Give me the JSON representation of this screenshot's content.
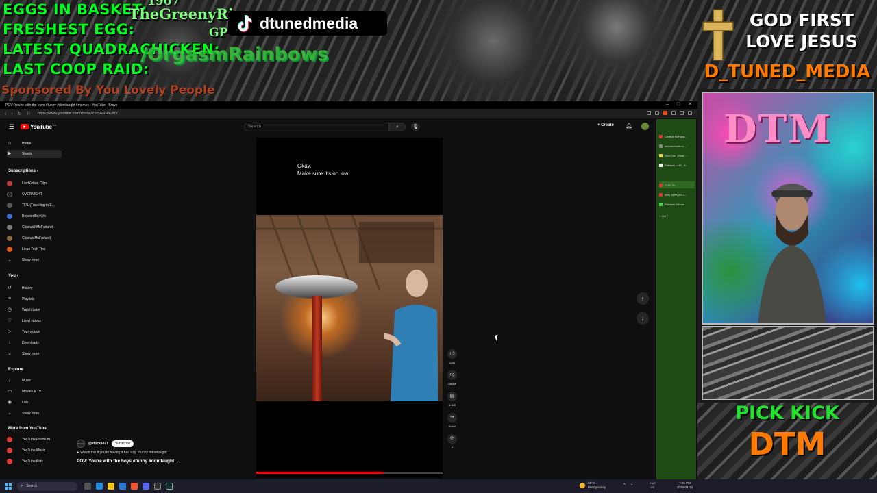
{
  "overlay": {
    "stats": [
      "EGGS IN BASKET:",
      "FRESHEST EGG:",
      "LATEST QUADRACHICKEN:",
      "LAST COOP RAID:"
    ],
    "latest_egg_user": "TheGreenyRi",
    "top_number": "1967",
    "gp_text": "GP",
    "raid_user": "/OrgasmRainbows",
    "sponsor": "Sponsored By You Lovely People",
    "tiktok_handle": "dtunedmedia",
    "slogan_line1": "GOD FIRST",
    "slogan_line2": "LOVE JESUS",
    "brand": "D_TUNED_MEDIA",
    "webcam_sign": "DTM",
    "pick_kick": "PICK KICK",
    "dtm_big": "DTM"
  },
  "browser": {
    "tab_title": "POV: You're with the boys #funny #dontlaught #memes - YouTube - Brave",
    "url": "https://www.youtube.com/shorts/Z5fSNRHYDbY",
    "window_controls": [
      "–",
      "□",
      "✕"
    ]
  },
  "youtube": {
    "logo": "YouTube",
    "country": "CA",
    "search_placeholder": "Search",
    "create_label": "Create",
    "sidebar": {
      "top": [
        {
          "label": "Home",
          "icon": "home-icon",
          "glyph": "⌂"
        },
        {
          "label": "Shorts",
          "icon": "shorts-icon",
          "glyph": "▶"
        }
      ],
      "subscriptions_head": "Subscriptions",
      "subscriptions": [
        {
          "label": "LordKebun Clips",
          "color": "#c23b3b"
        },
        {
          "label": "OVERNIGHT",
          "color": "#222222"
        },
        {
          "label": "TFIL (Traveling to E...",
          "color": "#555555"
        },
        {
          "label": "BoostedBoiKyle",
          "color": "#3a6fd0"
        },
        {
          "label": "Cleetus2 McFarland",
          "color": "#7a7a7a"
        },
        {
          "label": "Cleetus McFarland",
          "color": "#8a6a3a"
        },
        {
          "label": "Linus Tech Tips",
          "color": "#e05a1a"
        }
      ],
      "show_more_1": "Show more",
      "you_head": "You",
      "you": [
        {
          "label": "History",
          "icon": "history-icon",
          "glyph": "↺"
        },
        {
          "label": "Playlists",
          "icon": "playlists-icon",
          "glyph": "≡"
        },
        {
          "label": "Watch Later",
          "icon": "watch-later-icon",
          "glyph": "◷"
        },
        {
          "label": "Liked videos",
          "icon": "liked-icon",
          "glyph": "♡"
        },
        {
          "label": "Your videos",
          "icon": "your-videos-icon",
          "glyph": "▷"
        },
        {
          "label": "Downloads",
          "icon": "downloads-icon",
          "glyph": "↓"
        }
      ],
      "show_more_2": "Show more",
      "explore_head": "Explore",
      "explore": [
        {
          "label": "Music",
          "icon": "music-icon",
          "glyph": "♪"
        },
        {
          "label": "Movies & TV",
          "icon": "movies-icon",
          "glyph": "▭"
        },
        {
          "label": "Live",
          "icon": "live-icon",
          "glyph": "◉"
        }
      ],
      "show_more_3": "Show more",
      "more_head": "More from YouTube",
      "more": [
        {
          "label": "YouTube Premium",
          "color": "#e53935"
        },
        {
          "label": "YouTube Music",
          "color": "#e53935"
        },
        {
          "label": "YouTube Kids",
          "color": "#e53935"
        }
      ]
    },
    "short": {
      "caption_line1": "Okay.",
      "caption_line2": "Make sure it's on low.",
      "progress": 0.68,
      "channel": "@stuck4321",
      "channel_avatar": "STUCK",
      "subscribe": "Subscribe",
      "description": "Watch this if you're having a bad day. #funny #dontlaught",
      "title": "POV: You're with the boys #funny #dontlaught ...",
      "actions": [
        {
          "name": "like-icon",
          "glyph": "👍︎",
          "count": "229k"
        },
        {
          "name": "dislike-icon",
          "glyph": "👎︎",
          "count": "Dislike"
        },
        {
          "name": "comment-icon",
          "glyph": "▤",
          "count": "1,328"
        },
        {
          "name": "share-icon",
          "glyph": "↪",
          "count": "Share"
        },
        {
          "name": "remix-icon",
          "glyph": "⟳",
          "count": "2"
        }
      ]
    }
  },
  "vertical_tabs": [
    {
      "label": "Cleetus McFarla...",
      "color": "#e53935"
    },
    {
      "label": "streamcharts.co...",
      "color": "#888888"
    },
    {
      "label": "Your Cart - Best ...",
      "color": "#f4d03f"
    },
    {
      "label": "Fishtank LIVE - fi...",
      "color": "#ffffff"
    },
    {
      "label": "POV: Yo...",
      "color": "#e53935"
    },
    {
      "label": "Why JAPAN'S C...",
      "color": "#e53935"
    },
    {
      "label": "Fishtank Stream",
      "color": "#3ddc4a"
    },
    {
      "label": "+            Ctrl  T",
      "color": "#1e4a14"
    }
  ],
  "taskbar": {
    "search": "Search",
    "weather_temp": "21°C",
    "weather_desc": "Mostly sunny",
    "lang1": "ENG",
    "lang2": "US",
    "time": "7:05 PM",
    "date": "2025-04-14"
  }
}
